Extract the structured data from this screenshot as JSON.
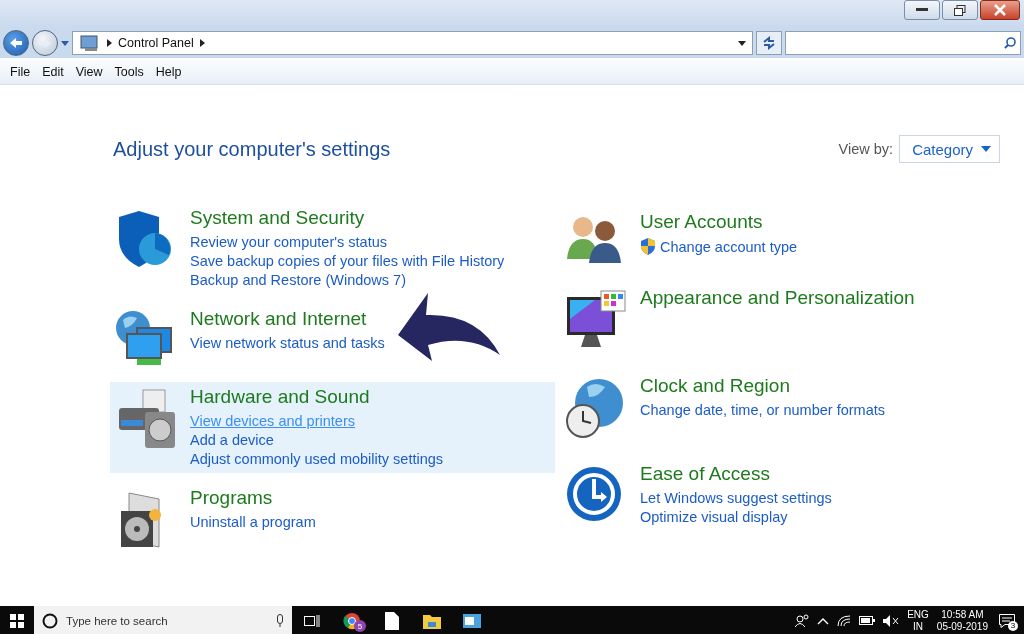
{
  "address_bar": {
    "breadcrumb": "Control Panel"
  },
  "menu": [
    "File",
    "Edit",
    "View",
    "Tools",
    "Help"
  ],
  "heading": "Adjust your computer's settings",
  "view_by": {
    "label": "View by:",
    "value": "Category"
  },
  "left_categories": [
    {
      "kind": "security",
      "title": "System and Security",
      "highlighted": false,
      "links": [
        {
          "text": "Review your computer's status",
          "hovered": false,
          "admin": false
        },
        {
          "text": "Save backup copies of your files with File History",
          "hovered": false,
          "admin": false
        },
        {
          "text": "Backup and Restore (Windows 7)",
          "hovered": false,
          "admin": false
        }
      ]
    },
    {
      "kind": "network",
      "title": "Network and Internet",
      "highlighted": false,
      "links": [
        {
          "text": "View network status and tasks",
          "hovered": false,
          "admin": false
        }
      ]
    },
    {
      "kind": "hardware",
      "title": "Hardware and Sound",
      "highlighted": true,
      "links": [
        {
          "text": "View devices and printers",
          "hovered": true,
          "admin": false
        },
        {
          "text": "Add a device",
          "hovered": false,
          "admin": false
        },
        {
          "text": "Adjust commonly used mobility settings",
          "hovered": false,
          "admin": false
        }
      ]
    },
    {
      "kind": "programs",
      "title": "Programs",
      "highlighted": false,
      "links": [
        {
          "text": "Uninstall a program",
          "hovered": false,
          "admin": false
        }
      ]
    }
  ],
  "right_categories": [
    {
      "kind": "accounts",
      "title": "User Accounts",
      "highlighted": false,
      "links": [
        {
          "text": "Change account type",
          "hovered": false,
          "admin": true
        }
      ]
    },
    {
      "kind": "appearance",
      "title": "Appearance and Personalization",
      "highlighted": false
    },
    {
      "kind": "clock",
      "title": "Clock and Region",
      "highlighted": false,
      "links": [
        {
          "text": "Change date, time, or number formats",
          "hovered": false,
          "admin": false
        }
      ]
    },
    {
      "kind": "ease",
      "title": "Ease of Access",
      "highlighted": false,
      "links": [
        {
          "text": "Let Windows suggest settings",
          "hovered": false,
          "admin": false
        },
        {
          "text": "Optimize visual display",
          "hovered": false,
          "admin": false
        }
      ]
    }
  ],
  "taskbar": {
    "search_placeholder": "Type here to search",
    "apps": [
      {
        "kind": "browser",
        "badge": "5"
      },
      {
        "kind": "file"
      },
      {
        "kind": "folder"
      },
      {
        "kind": "app"
      }
    ],
    "language": "ENG",
    "region": "IN",
    "time": "10:58 AM",
    "date": "05-09-2019",
    "notifications": "3"
  }
}
